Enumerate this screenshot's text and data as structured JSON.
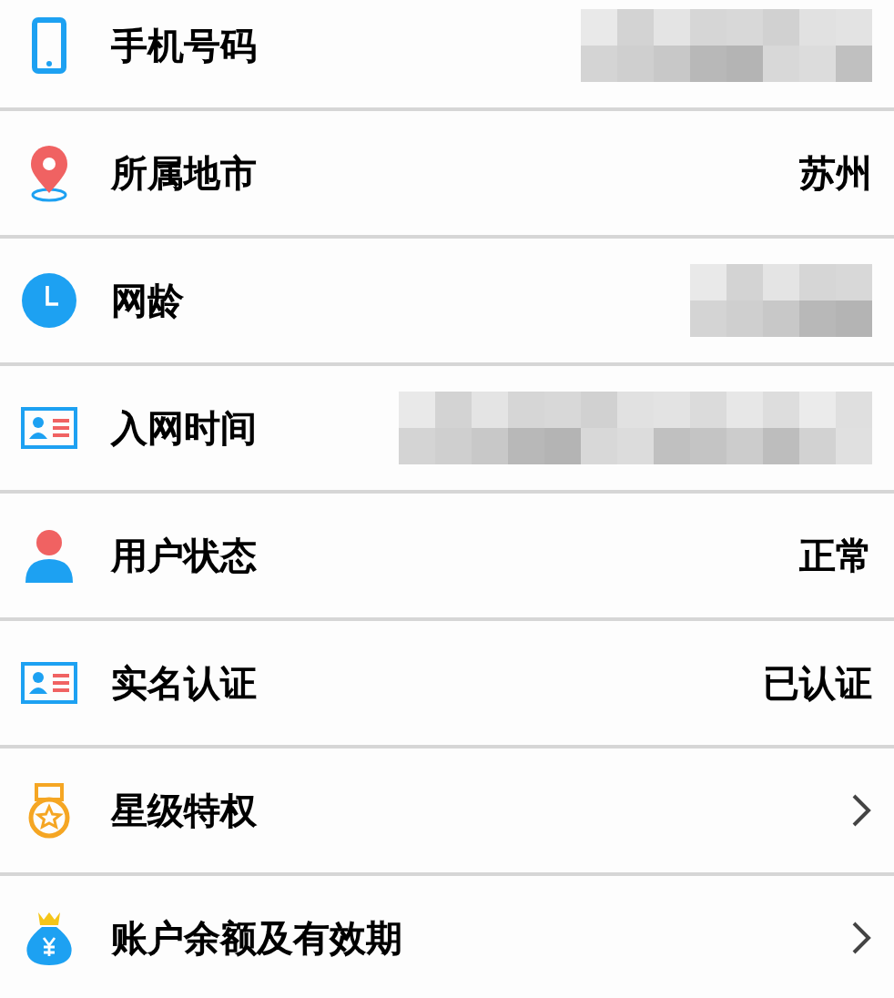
{
  "rows": [
    {
      "label": "手机号码",
      "value": {
        "kind": "redacted"
      }
    },
    {
      "label": "所属地市",
      "value": {
        "kind": "text",
        "text": "苏州"
      }
    },
    {
      "label": "网龄",
      "value": {
        "kind": "redacted"
      }
    },
    {
      "label": "入网时间",
      "value": {
        "kind": "redacted"
      }
    },
    {
      "label": "用户状态",
      "value": {
        "kind": "text",
        "text": "正常"
      }
    },
    {
      "label": "实名认证",
      "value": {
        "kind": "text",
        "text": "已认证"
      }
    },
    {
      "label": "星级特权",
      "value": {
        "kind": "chevron"
      }
    },
    {
      "label": "账户余额及有效期",
      "value": {
        "kind": "chevron"
      }
    }
  ]
}
